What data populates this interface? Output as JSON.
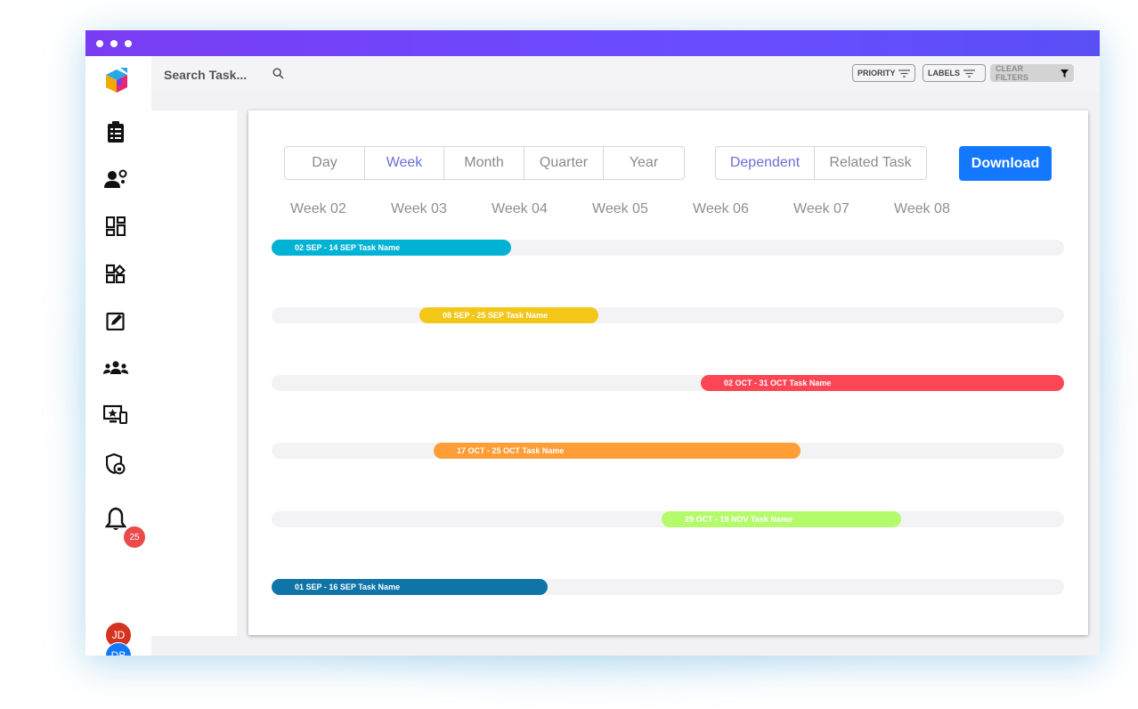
{
  "search": {
    "placeholder": "Search Task..."
  },
  "filters": {
    "priority": "PRIORITY",
    "labels": "LABELS",
    "clear": "CLEAR FILTERS"
  },
  "notifications": {
    "count": "25"
  },
  "avatars": [
    {
      "initials": "JD",
      "color": "#d6331f"
    },
    {
      "initials": "DB",
      "color": "#1478ff"
    }
  ],
  "view_modes": [
    "Day",
    "Week",
    "Month",
    "Quarter",
    "Year"
  ],
  "active_view": "Week",
  "link_modes": [
    "Dependent",
    "Related Task"
  ],
  "active_link": "Dependent",
  "download_label": "Download",
  "weeks": [
    "Week 02",
    "Week 03",
    "Week 04",
    "Week 05",
    "Week 06",
    "Week 07",
    "Week 08"
  ],
  "tasks": [
    {
      "label": "02 SEP - 14 SEP Task Name",
      "color": "#00b3d4"
    },
    {
      "label": "08 SEP - 25 SEP Task Name",
      "color": "#f2c718"
    },
    {
      "label": "02 OCT - 31 OCT Task Name",
      "color": "#fc4555"
    },
    {
      "label": "17 OCT - 25 OCT Task Name",
      "color": "#ff9d36"
    },
    {
      "label": "29 OCT - 19 NOV Task Name",
      "color": "#b4fb6c"
    },
    {
      "label": "01 SEP - 16 SEP Task Name",
      "color": "#0f74a8"
    }
  ],
  "colors": {
    "accent": "#6a4cff",
    "primary": "#1478ff",
    "active_text": "#6b6fd6"
  }
}
